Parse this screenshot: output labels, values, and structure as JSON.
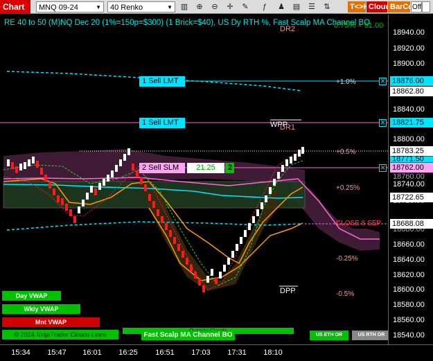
{
  "toolbar": {
    "chart_tab": "Chart",
    "instrument": "MNQ 09-24",
    "bar_type": "40 Renko",
    "tk_label": "T<>K",
    "cloud_label": "Cloud",
    "barco_label": "BarCo",
    "off_label": "Off"
  },
  "chart": {
    "title": "RE 40 to 50 (M)NQ Dec 20 (1%=150p=$300) (1 Brick=$40), US Dy RTH %, Fast Scalp MA Channel BO",
    "title_tail": "0.75% = 91.00",
    "levels": {
      "dr2": "DR2",
      "dr1": "DR1",
      "wpp": "WPP",
      "dpp": "DPP",
      "pct_plus_1": "+1.0%",
      "pct_plus_05": "+0.5%",
      "pct_plus_025": "+0.25%",
      "close_8sep": "CLOSE 8 SEP",
      "pct_minus_025": "-0.25%",
      "pct_minus_05": "-0.5%"
    },
    "orders": {
      "sell_lmt_1": "1 Sell LMT",
      "sell_lmt_2": "1 Sell LMT",
      "sell_slm": "2 Sell SLM",
      "slm_price": "21.25",
      "slm_count": "2"
    },
    "legend": {
      "day_vwap": "Day VWAP",
      "wkly_vwap": "Wkly VWAP",
      "mnt_vwap": "Mnt VWAP",
      "copyright": "© 2024 NinjaTrader Clouds Lines",
      "outside_clouds": "Outside Clouds",
      "fast_scalp": "Fast Scalp MA Channel BO",
      "us_eth": "US ETH OR",
      "us_rth": "US RTH OR"
    }
  },
  "price_axis": {
    "ticks": [
      "18940.00",
      "18920.00",
      "18900.00",
      "18860.00",
      "18840.00",
      "18800.00",
      "18760.00",
      "18740.00",
      "18720.00",
      "18680.00",
      "18660.00",
      "18640.00",
      "18620.00",
      "18600.00",
      "18580.00",
      "18560.00",
      "18540.00"
    ],
    "boxes": {
      "p18876": "18876.00",
      "p18862": "18862.80",
      "p18821": "18821.75",
      "p18783": "18783.25",
      "p18771": "18771.50",
      "p18762": "18762.00",
      "p18722": "18722.65",
      "p18688": "18688.08"
    }
  },
  "time_axis": {
    "labels": [
      "15:34",
      "15:47",
      "16:01",
      "16:25",
      "16:51",
      "17:03",
      "17:31",
      "18:10"
    ]
  },
  "colors": {
    "up_brick": "#ffffff",
    "down_brick": "#ff1a1a",
    "cyan": "#00e5ff",
    "magenta": "#ff66dd",
    "orange": "#ff9900",
    "green": "#00c000"
  }
}
